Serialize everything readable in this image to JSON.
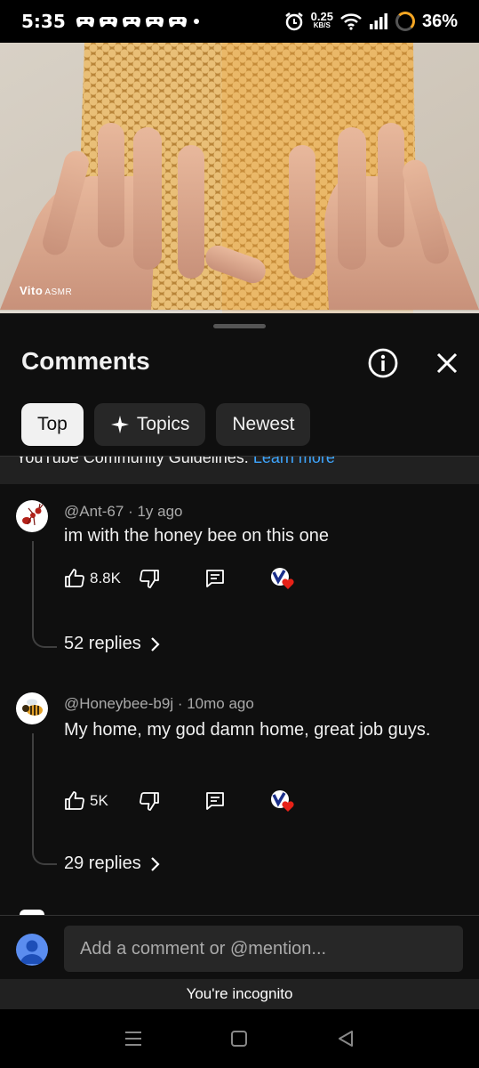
{
  "status_bar": {
    "time": "5:35",
    "net_speed_value": "0.25",
    "net_speed_unit": "KB/S",
    "battery": "36%"
  },
  "video": {
    "watermark_brand": "Vito",
    "watermark_sub": "ASMR"
  },
  "comments_panel": {
    "title": "Comments",
    "chips": [
      {
        "label": "Top",
        "active": true
      },
      {
        "label": "Topics",
        "active": false
      },
      {
        "label": "Newest",
        "active": false
      }
    ],
    "guidelines_text": "YouTube Community Guidelines.",
    "guidelines_link": "Learn more"
  },
  "comments": [
    {
      "author": "@Ant-67",
      "age": "1y ago",
      "text": "im with the honey bee on this one",
      "likes": "8.8K",
      "replies": "52 replies"
    },
    {
      "author": "@Honeybee-b9j",
      "age": "10mo ago",
      "text": "My home, my god damn home, great job guys.",
      "likes": "5K",
      "replies": "29 replies"
    }
  ],
  "composer": {
    "placeholder": "Add a comment or @mention..."
  },
  "incognito_text": "You're incognito",
  "colors": {
    "background": "#0f0f0f",
    "link": "#3ea6ff",
    "heart": "#e62117"
  }
}
